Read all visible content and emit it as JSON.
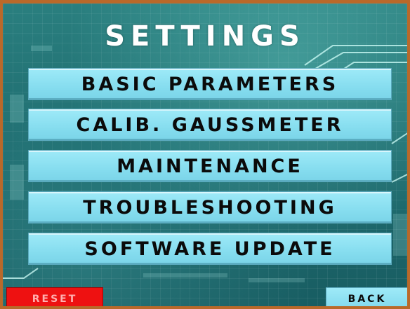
{
  "screen": {
    "title": "SETTINGS"
  },
  "menu": {
    "items": [
      {
        "label": "BASIC PARAMETERS"
      },
      {
        "label": "CALIB. GAUSSMETER"
      },
      {
        "label": "MAINTENANCE"
      },
      {
        "label": "TROUBLESHOOTING"
      },
      {
        "label": "SOFTWARE UPDATE"
      }
    ]
  },
  "footer": {
    "reset_label": "RESET",
    "back_label": "BACK"
  },
  "colors": {
    "frame": "#b9692a",
    "background": "#1f6d70",
    "button": "#8ee0f2",
    "reset": "#ee1111"
  }
}
